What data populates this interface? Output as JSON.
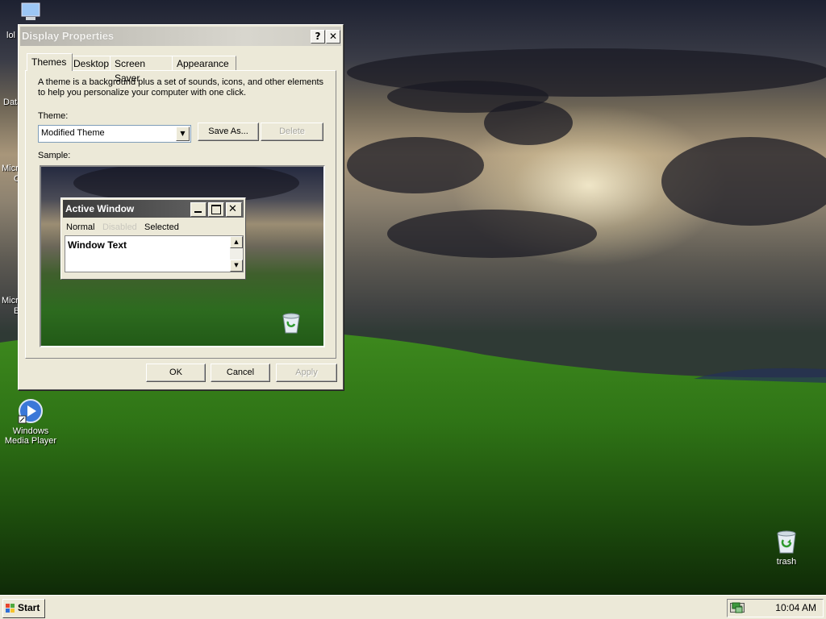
{
  "desktop": {
    "icons": [
      {
        "label": "Windows Media Player"
      },
      {
        "label": "trash"
      }
    ],
    "edge_labels": [
      "lol",
      "Data",
      "Micro",
      "C",
      "Micro",
      "B"
    ]
  },
  "dialog": {
    "title": "Display Properties",
    "help_button": "?",
    "close_button": "✕",
    "tabs": [
      {
        "label": "Themes"
      },
      {
        "label": "Desktop"
      },
      {
        "label": "Screen Saver"
      },
      {
        "label": "Appearance"
      }
    ],
    "description_line1": "A theme is a background plus a set of sounds, icons, and other elements",
    "description_line2": "to help you personalize your computer with one click.",
    "theme_label": "Theme:",
    "theme_value": "Modified Theme",
    "save_as_label": "Save As...",
    "delete_label": "Delete",
    "sample_label": "Sample:",
    "sample": {
      "window_title": "Active Window",
      "menu_normal": "Normal",
      "menu_disabled": "Disabled",
      "menu_selected": "Selected",
      "window_text": "Window Text"
    },
    "ok_label": "OK",
    "cancel_label": "Cancel",
    "apply_label": "Apply"
  },
  "taskbar": {
    "start_label": "Start",
    "clock": "10:04 AM"
  },
  "colors": {
    "dialog_face": "#ece9d8",
    "title_inactive": "#d8d6ce",
    "active_title": "#3b3b3b"
  }
}
